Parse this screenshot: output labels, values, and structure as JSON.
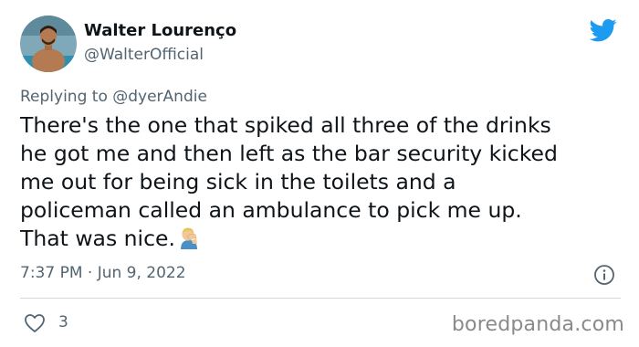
{
  "author": {
    "display_name": "Walter Lourenço",
    "handle": "@WalterOfficial",
    "avatar_icon": "avatar-photo"
  },
  "brand": {
    "icon": "twitter-bird-icon",
    "color": "#1d9bf0"
  },
  "reply": {
    "prefix": "Replying to",
    "mention": "@dyerAndie"
  },
  "tweet": {
    "lines": [
      "There's the one that spiked all three of the drinks",
      "he got me and then left as the bar security kicked",
      "me out for being sick in the toilets and a",
      "policeman called an ambulance to pick me up.",
      "That was nice."
    ],
    "emoji": "🤦‍♂️",
    "emoji_icon": "facepalm-emoji"
  },
  "meta": {
    "timestamp": "7:37 PM · Jun 9, 2022"
  },
  "actions": {
    "like_count": "3"
  },
  "watermark": {
    "text": "boredpanda.com"
  }
}
